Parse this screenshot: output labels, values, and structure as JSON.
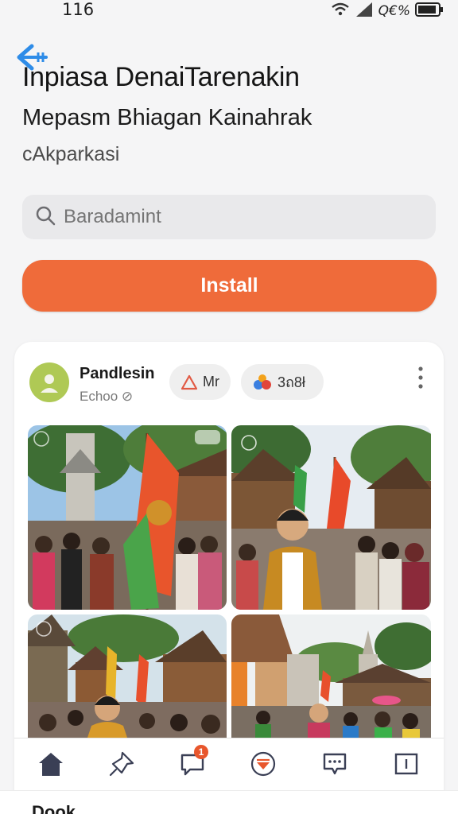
{
  "status_bar": {
    "time": "116",
    "battery_text": "Q€%",
    "icons": [
      "wifi-icon",
      "signal-icon",
      "battery-icon"
    ]
  },
  "header": {
    "back_icon": "back-arrow-icon",
    "title": "Inpiasa DenaiTarenakin",
    "subtitle": "Mepasm Bhiagan Kainahrak",
    "developer": "cAkparkasi"
  },
  "search": {
    "placeholder": "Baradamint",
    "icon": "search-icon"
  },
  "install": {
    "label": "Install",
    "color": "#ef6b3a"
  },
  "post": {
    "author": "Pandlesin",
    "meta": "Echoo ⊘",
    "chips": [
      {
        "icon": "warning-icon",
        "label": "Mr"
      },
      {
        "icon": "multicolor-dots-icon",
        "label": "3ถ8ł"
      }
    ],
    "more_icon": "more-vertical-icon",
    "photos": [
      {
        "label": "festival-flag-photo"
      },
      {
        "label": "festival-crowd-photo"
      },
      {
        "label": "festival-street-photo"
      },
      {
        "label": "festival-temple-photo"
      }
    ]
  },
  "nav": {
    "items": [
      {
        "icon": "home-icon"
      },
      {
        "icon": "pin-icon"
      },
      {
        "icon": "chat-bubble-icon",
        "badge": "1"
      },
      {
        "icon": "media-icon"
      },
      {
        "icon": "message-icon"
      },
      {
        "icon": "square-icon"
      }
    ]
  },
  "bottom_peek": {
    "text": "Dook"
  }
}
